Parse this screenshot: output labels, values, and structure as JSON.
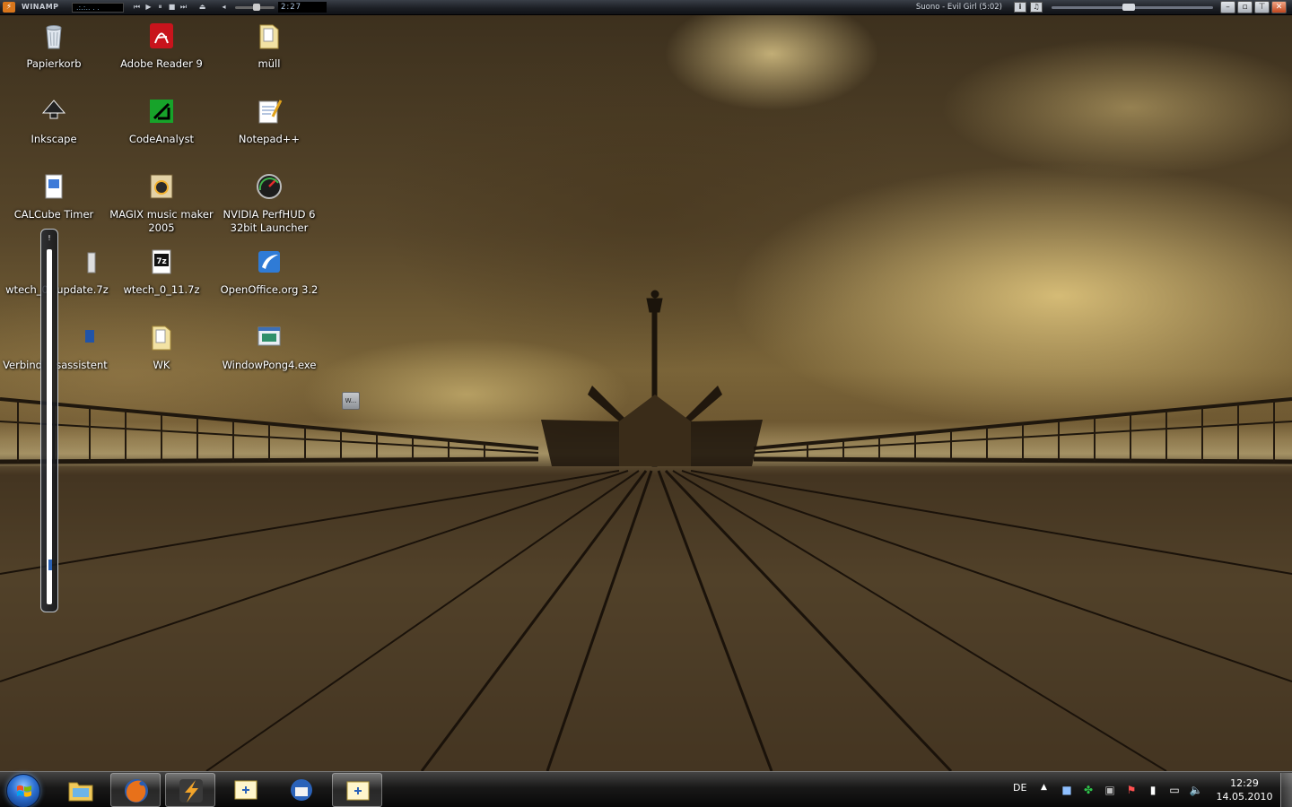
{
  "winamp": {
    "app_title": "WINAMP",
    "vis_text": ".:.:.. . .",
    "time": "2:27",
    "track_title": "Suono - Evil Girl (5:02)",
    "info_btn": "i",
    "lib_btn": "♫",
    "volume_fraction": 0.55,
    "seek_fraction": 0.48
  },
  "desktop_icons": [
    {
      "label": "Papierkorb",
      "icon": "recycle-bin-icon"
    },
    {
      "label": "Adobe Reader 9",
      "icon": "adobe-reader-icon"
    },
    {
      "label": "müll",
      "icon": "folder-icon"
    },
    {
      "label": "Inkscape",
      "icon": "inkscape-icon"
    },
    {
      "label": "CodeAnalyst",
      "icon": "codeanalyst-icon"
    },
    {
      "label": "Notepad++",
      "icon": "notepad-icon"
    },
    {
      "label": "CALCube Timer",
      "icon": "calcube-icon"
    },
    {
      "label": "MAGIX music maker 2005",
      "icon": "magix-icon"
    },
    {
      "label": "NVIDIA PerfHUD 6 32bit Launcher",
      "icon": "perfhud-icon"
    },
    {
      "label": "wtech_0",
      "icon": "archive-icon"
    },
    {
      "label": "update.7z",
      "icon": "archive-icon"
    },
    {
      "label": "wtech_0_11.7z",
      "icon": "7z-icon"
    },
    {
      "label": "OpenOffice.org 3.2",
      "icon": "openoffice-icon"
    },
    {
      "label": "Verbind",
      "icon": "network-icon"
    },
    {
      "label": "sassistent",
      "icon": "network-icon"
    },
    {
      "label": "WK",
      "icon": "folder-icon"
    },
    {
      "label": "WindowPong4.exe",
      "icon": "exe-icon"
    }
  ],
  "mini_window_label": "W...",
  "taskbar": {
    "start_icon": "windows-start-icon",
    "buttons": [
      {
        "icon": "explorer-icon",
        "active": false
      },
      {
        "icon": "firefox-icon",
        "active": true
      },
      {
        "icon": "winamp-icon",
        "active": true
      },
      {
        "icon": "windowpong-icon",
        "active": false
      },
      {
        "icon": "thunderbird-icon",
        "active": false
      },
      {
        "icon": "windowpong-icon",
        "active": true
      }
    ],
    "language": "DE",
    "tray_arrow": "▲",
    "clock_time": "12:29",
    "clock_date": "14.05.2010"
  },
  "colors": {
    "sepia_dark": "#2a2014",
    "sky_light": "#e8cd82",
    "taskbar": "#111111",
    "winamp_orange": "#d8761c"
  }
}
